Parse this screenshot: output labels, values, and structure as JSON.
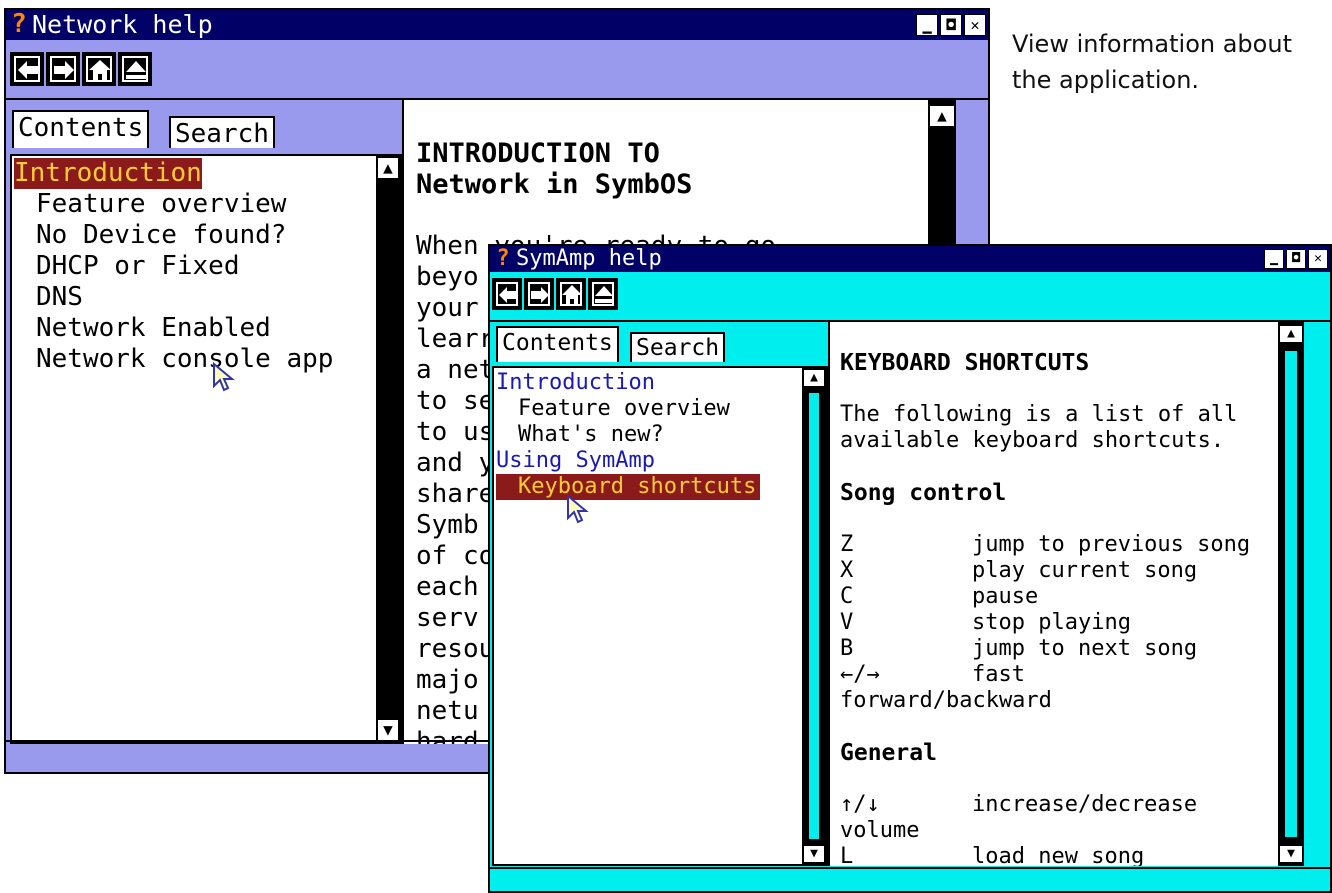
{
  "caption": "View information about the application.",
  "network_help": {
    "title": "Network help",
    "tabs": {
      "contents": "Contents",
      "search": "Search"
    },
    "toc": [
      {
        "label": "Introduction",
        "selected": true,
        "indent": false
      },
      {
        "label": "Feature overview",
        "selected": false,
        "indent": true
      },
      {
        "label": "No Device found?",
        "selected": false,
        "indent": true
      },
      {
        "label": "DHCP or Fixed",
        "selected": false,
        "indent": true
      },
      {
        "label": "DNS",
        "selected": false,
        "indent": true
      },
      {
        "label": "Network Enabled",
        "selected": false,
        "indent": true
      },
      {
        "label": "Network console app",
        "selected": false,
        "indent": true
      }
    ],
    "doc_heading_1": "INTRODUCTION TO",
    "doc_heading_2": "Network in SymbOS",
    "doc_lines": [
      "When you're ready to go",
      "beyo",
      "your",
      "learr",
      "a net",
      "to se",
      "to us",
      "and y",
      "share",
      "Symb",
      "of co",
      "each",
      "serv",
      "resou",
      "majo",
      "netu",
      "hard"
    ]
  },
  "symamp_help": {
    "title": "SymAmp help",
    "tabs": {
      "contents": "Contents",
      "search": "Search"
    },
    "toc": [
      {
        "label": "Introduction",
        "indent": false
      },
      {
        "label": "Feature overview",
        "indent": true
      },
      {
        "label": "What's new?",
        "indent": true
      },
      {
        "label": "Using SymAmp",
        "indent": false
      },
      {
        "label": "Keyboard shortcuts",
        "indent": true,
        "selected": true
      }
    ],
    "doc_heading": "KEYBOARD SHORTCUTS",
    "doc_intro_1": "The following is a list of all",
    "doc_intro_2": "available keyboard shortcuts.",
    "section_song": "Song control",
    "song_shortcuts": [
      {
        "key": "Z",
        "action": "jump to previous song"
      },
      {
        "key": "X",
        "action": "play current song"
      },
      {
        "key": "C",
        "action": "pause"
      },
      {
        "key": "V",
        "action": "stop playing"
      },
      {
        "key": "B",
        "action": "jump to next song"
      },
      {
        "key": "←/→",
        "action": "fast"
      }
    ],
    "song_wrap": "forward/backward",
    "section_general": "General",
    "general_shortcuts": [
      {
        "key": "↑/↓",
        "action": "increase/decrease"
      }
    ],
    "general_wrap": "volume",
    "general_last": {
      "key": "L",
      "action": "load new song"
    }
  },
  "colors": {
    "title_bg": "#000066",
    "win1_frame": "#9999ee",
    "win2_frame": "#00eeee",
    "selection_bg": "#8b1a1a",
    "selection_fg": "#ffcc33",
    "link_blue": "#1a1ab0"
  }
}
